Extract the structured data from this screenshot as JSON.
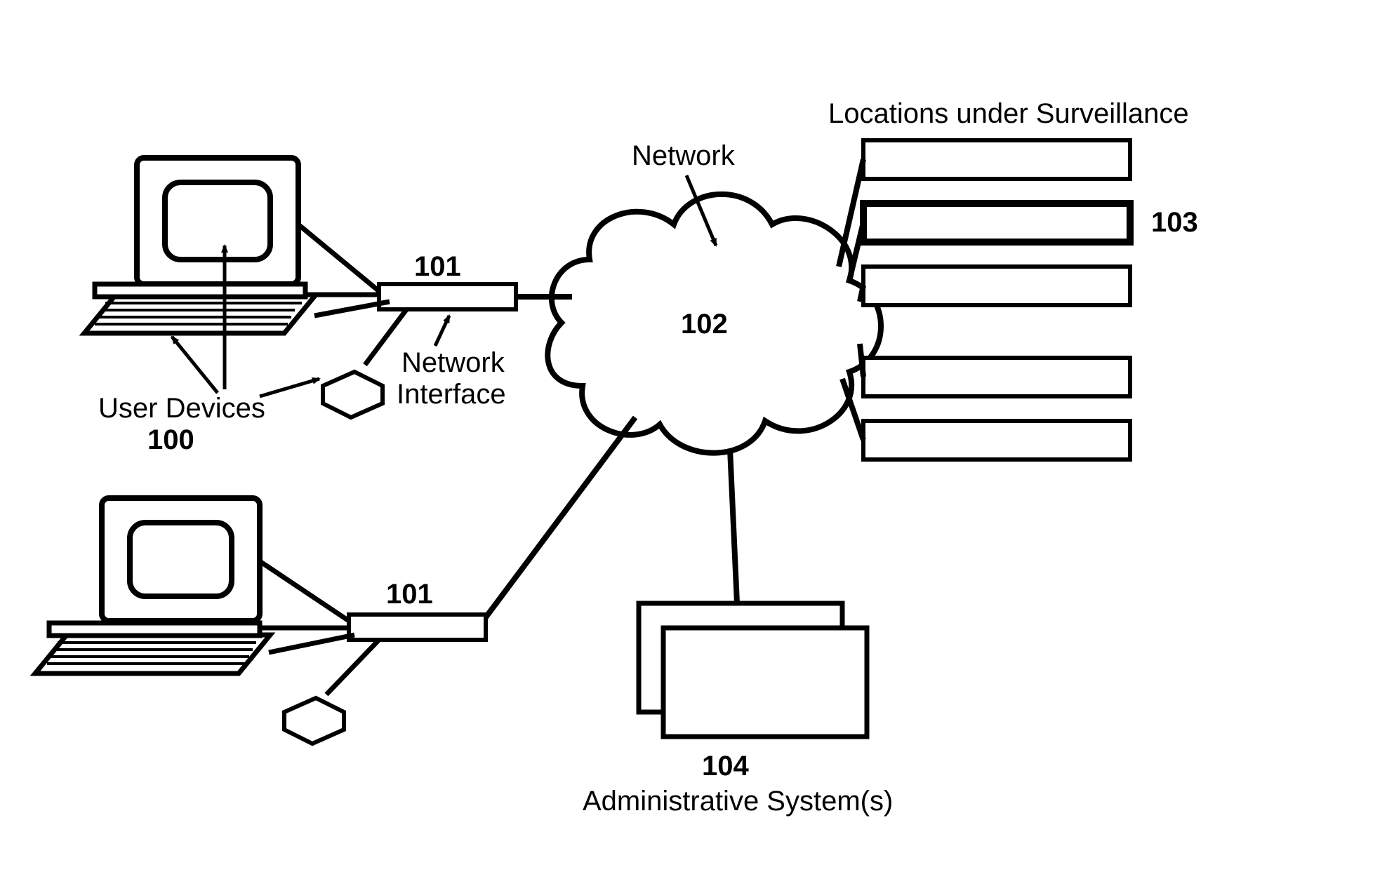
{
  "labels": {
    "locations_title": "Locations under Surveillance",
    "network": "Network",
    "network_interface_l1": "Network",
    "network_interface_l2": "Interface",
    "user_devices": "User Devices",
    "admin": "Administrative System(s)"
  },
  "refs": {
    "r100": "100",
    "r101": "101",
    "r102": "102",
    "r103": "103",
    "r104": "104"
  }
}
